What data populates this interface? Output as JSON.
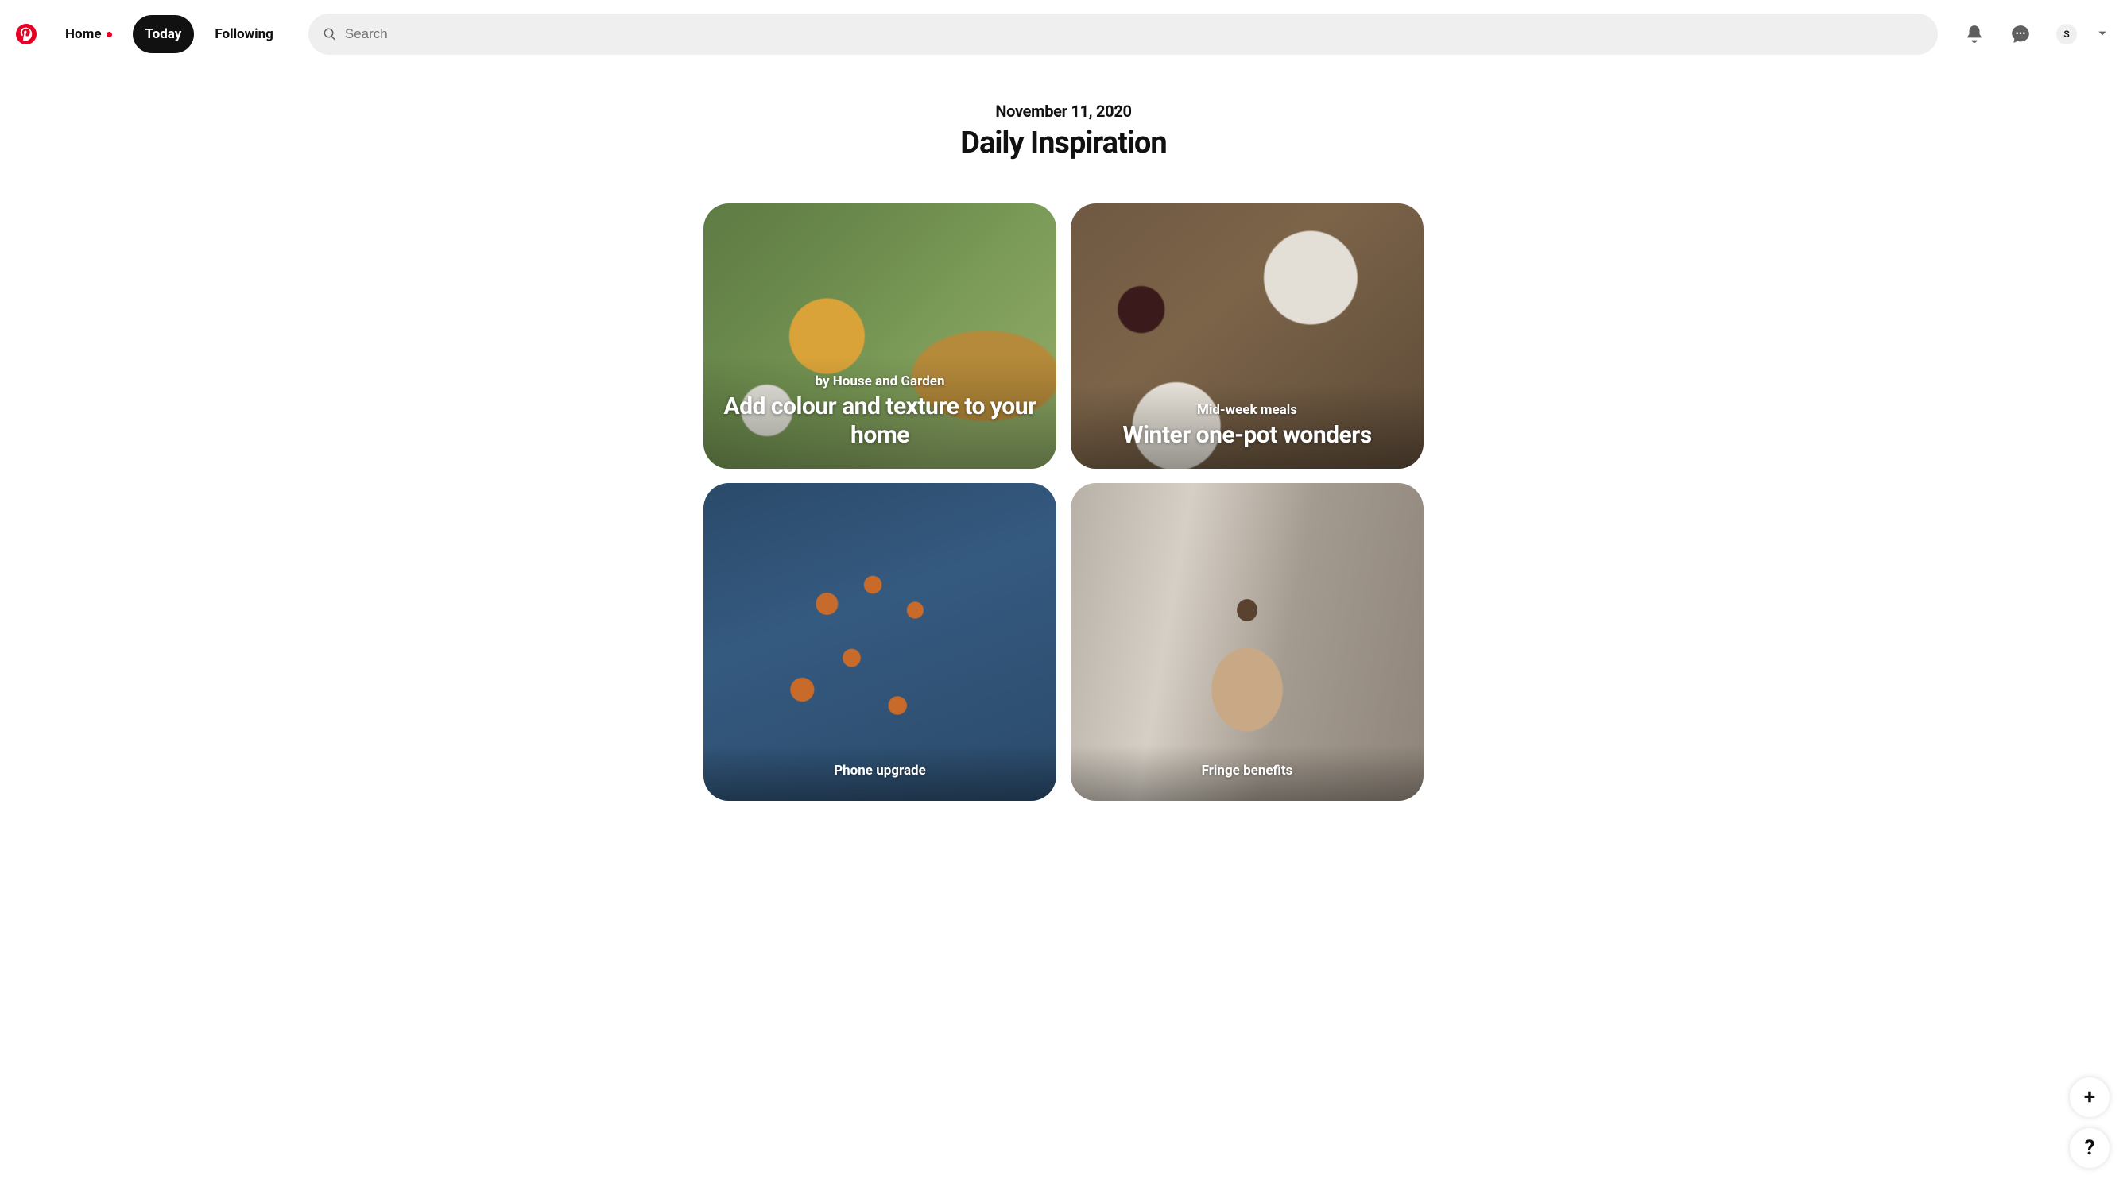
{
  "header": {
    "nav": {
      "home": "Home",
      "today": "Today",
      "following": "Following"
    },
    "search_placeholder": "Search",
    "avatar_initial": "S"
  },
  "main": {
    "date": "November 11, 2020",
    "title": "Daily Inspiration",
    "cards": [
      {
        "subtitle": "by House and Garden",
        "title": "Add colour and texture to your home"
      },
      {
        "subtitle": "Mid-week meals",
        "title": "Winter one-pot wonders"
      },
      {
        "subtitle": "Phone upgrade",
        "title": ""
      },
      {
        "subtitle": "Fringe benefits",
        "title": ""
      }
    ]
  },
  "fab": {
    "add": "+",
    "help": "?"
  }
}
